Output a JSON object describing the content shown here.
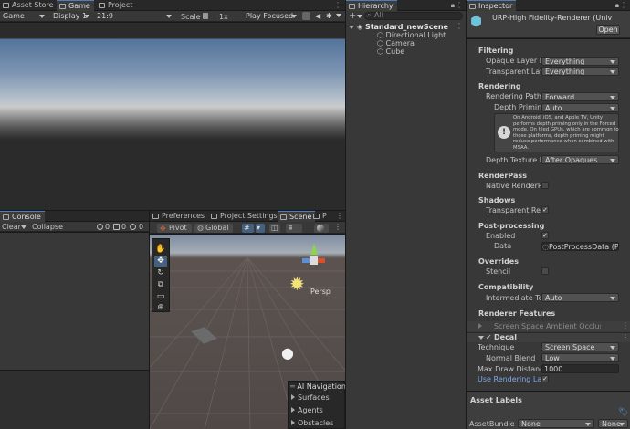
{
  "top_tabs": {
    "asset_store": "Asset Store",
    "game": "Game",
    "project": "Project"
  },
  "game_toolbar": {
    "mode": "Game",
    "display": "Display 1",
    "aspect": "21:9",
    "scale_label": "Scale",
    "scale_value": "1x",
    "play_mode": "Play Focused"
  },
  "hierarchy": {
    "title": "Hierarchy",
    "search_placeholder": "All",
    "scene": "Standard_newScene",
    "items": [
      "Directional Light",
      "Camera",
      "Cube"
    ]
  },
  "console": {
    "title": "Console",
    "clear": "Clear",
    "collapse": "Collapse",
    "count_info": "0",
    "count_warn": "0",
    "count_error": "0"
  },
  "scene_tabs": {
    "preferences": "Preferences",
    "project_settings": "Project Settings",
    "scene": "Scene",
    "extra": "P"
  },
  "scene_toolbar": {
    "pivot": "Pivot",
    "global": "Global",
    "persp": "Persp"
  },
  "overlay": {
    "title": "AI Navigation",
    "items": [
      "Surfaces",
      "Agents",
      "Obstacles"
    ]
  },
  "inspector": {
    "title": "Inspector",
    "asset_name": "URP-High Fidelity-Renderer (Univ",
    "open_button": "Open",
    "filtering": {
      "header": "Filtering",
      "opaque_label": "Opaque Layer Mas",
      "opaque_value": "Everything",
      "transparent_label": "Transparent Layer",
      "transparent_value": "Everything"
    },
    "rendering": {
      "header": "Rendering",
      "path_label": "Rendering Path",
      "path_value": "Forward",
      "depth_priming_label": "Depth Priming M",
      "depth_priming_value": "Auto",
      "info": "On Android, iOS, and Apple TV, Unity performs depth priming only in the Forced mode. On tiled GPUs, which are common to those platforms, depth priming might reduce performance when combined with MSAA.",
      "depth_texture_label": "Depth Texture Moc",
      "depth_texture_value": "After Opaques"
    },
    "renderpass": {
      "header": "RenderPass",
      "native_label": "Native RenderPass"
    },
    "shadows": {
      "header": "Shadows",
      "transparent_label": "Transparent Recei"
    },
    "post_processing": {
      "header": "Post-processing",
      "enabled_label": "Enabled",
      "data_label": "Data",
      "data_value": "PostProcessData (Po"
    },
    "overrides": {
      "header": "Overrides",
      "stencil_label": "Stencil"
    },
    "compatibility": {
      "header": "Compatibility",
      "intermediate_label": "Intermediate Textu",
      "intermediate_value": "Auto"
    },
    "renderer_features": {
      "header": "Renderer Features",
      "ssao_label": "Screen Space Ambient Occlusion",
      "decal_label": "Decal",
      "technique_label": "Technique",
      "technique_value": "Screen Space",
      "normal_blend_label": "Normal Blend",
      "normal_blend_value": "Low",
      "max_draw_label": "Max Draw Distance",
      "max_draw_value": "1000",
      "use_layers_label": "Use Rendering Layers"
    },
    "asset_labels": "Asset Labels",
    "asset_bundle_label": "AssetBundle",
    "asset_bundle_value": "None",
    "asset_bundle_variant": "None"
  },
  "colors": {
    "accent": "#4a7fbf",
    "link": "#7fa9e8",
    "panel": "#383838",
    "background": "#191919"
  }
}
